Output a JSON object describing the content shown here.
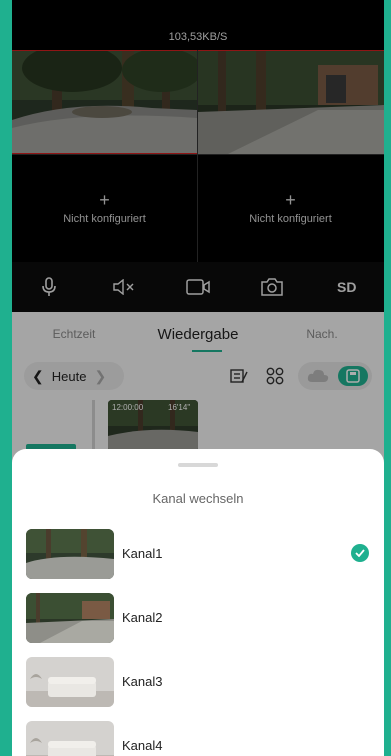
{
  "video": {
    "bitrate": "103,53KB/S",
    "tiles": [
      {
        "label": "Nicht konfiguriert"
      },
      {
        "label": "Nicht konfiguriert"
      }
    ],
    "plus_glyph": "+"
  },
  "controls": {
    "items": [
      "microphone-icon",
      "speaker-mute-icon",
      "record-icon",
      "snapshot-icon"
    ],
    "quality_label": "SD"
  },
  "tabs": {
    "items": [
      {
        "label": "Echtzeit",
        "active": false
      },
      {
        "label": "Wiedergabe",
        "active": true
      },
      {
        "label": "Nach.",
        "active": false
      }
    ]
  },
  "datebar": {
    "date_label": "Heute",
    "prev_icon": "chevron-left-icon",
    "next_icon": "chevron-right-icon",
    "tools": [
      "edit-list-icon",
      "grid-icon"
    ],
    "toggle": {
      "cloud_icon": "cloud-icon",
      "sd_icon": "sd-card-icon"
    }
  },
  "timeline": {
    "clip_start": "12:00:00",
    "clip_duration": "16'14\""
  },
  "sheet": {
    "title": "Kanal wechseln",
    "channels": [
      {
        "name": "Kanal1",
        "selected": true
      },
      {
        "name": "Kanal2",
        "selected": false
      },
      {
        "name": "Kanal3",
        "selected": false
      },
      {
        "name": "Kanal4",
        "selected": false
      }
    ]
  },
  "colors": {
    "accent": "#1fb08f",
    "frame": "#1fb08f",
    "video_bg": "#000000",
    "sheet_bg": "#ffffff"
  }
}
